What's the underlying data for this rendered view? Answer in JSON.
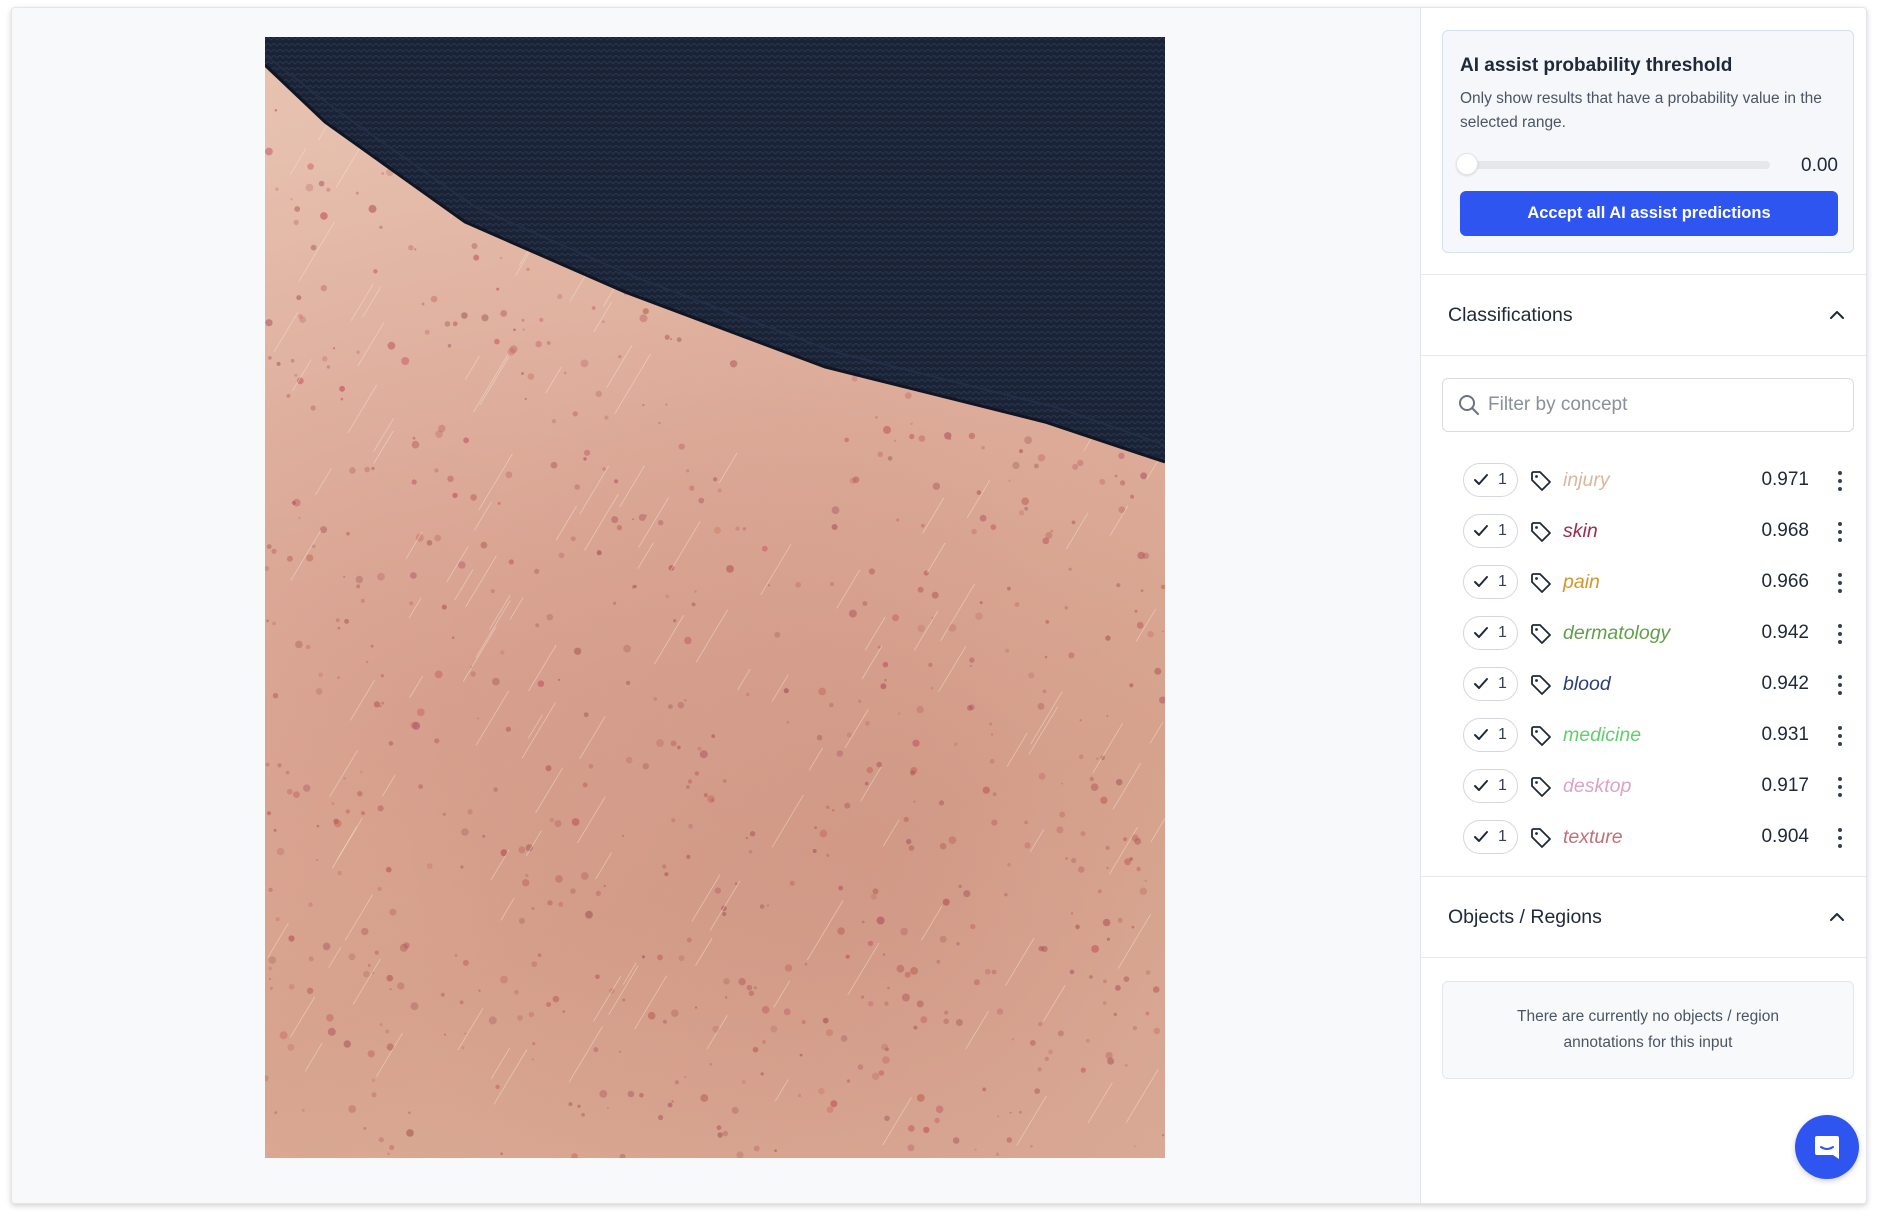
{
  "ai_assist": {
    "title": "AI assist probability threshold",
    "description": "Only show results that have a probability value in the selected range.",
    "threshold_value": "0.00",
    "threshold_fraction": 0.0,
    "accept_button": "Accept all AI assist predictions"
  },
  "classifications": {
    "title": "Classifications",
    "filter_placeholder": "Filter by concept",
    "concepts": [
      {
        "name": "injury",
        "value": "0.971",
        "count": "1",
        "color": "#d9b79c"
      },
      {
        "name": "skin",
        "value": "0.968",
        "count": "1",
        "color": "#9b2d4a"
      },
      {
        "name": "pain",
        "value": "0.966",
        "count": "1",
        "color": "#d4962a"
      },
      {
        "name": "dermatology",
        "value": "0.942",
        "count": "1",
        "color": "#5fa14a"
      },
      {
        "name": "blood",
        "value": "0.942",
        "count": "1",
        "color": "#2b3f72"
      },
      {
        "name": "medicine",
        "value": "0.931",
        "count": "1",
        "color": "#5fd06a"
      },
      {
        "name": "desktop",
        "value": "0.917",
        "count": "1",
        "color": "#dba3c8"
      },
      {
        "name": "texture",
        "value": "0.904",
        "count": "1",
        "color": "#c2707a"
      }
    ]
  },
  "regions": {
    "title": "Objects / Regions",
    "empty_message": "There are currently no objects / region annotations for this input"
  },
  "colors": {
    "accent": "#2f55f0",
    "fabric": "#1a2235",
    "skin": "#e0b09d"
  }
}
